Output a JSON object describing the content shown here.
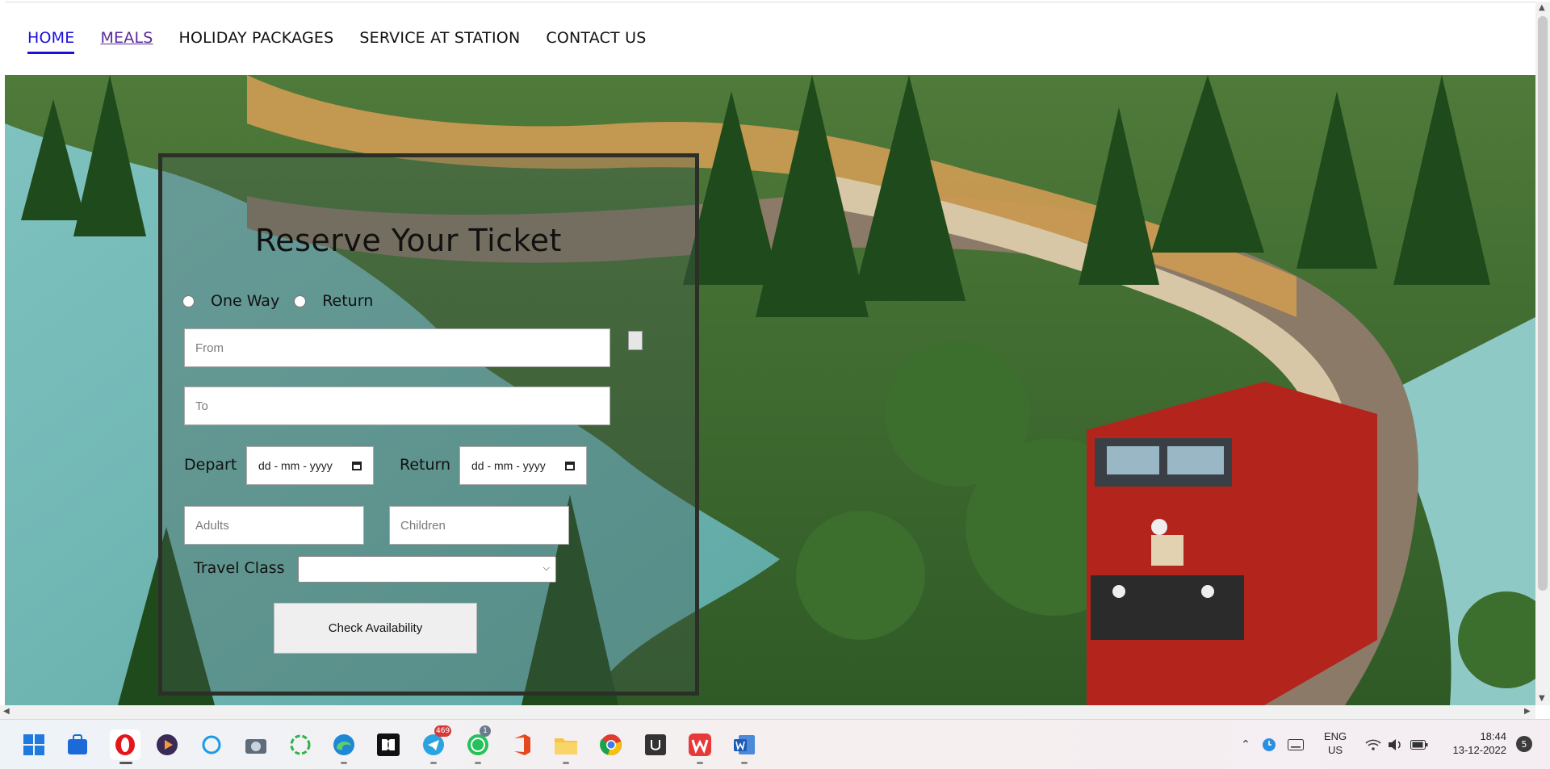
{
  "nav": {
    "items": [
      {
        "label": "HOME",
        "state": "active"
      },
      {
        "label": "MEALS",
        "state": "visited"
      },
      {
        "label": "HOLIDAY PACKAGES",
        "state": "normal"
      },
      {
        "label": "SERVICE AT STATION",
        "state": "normal"
      },
      {
        "label": "CONTACT US",
        "state": "normal"
      }
    ]
  },
  "booking": {
    "title": "Reserve Your Ticket",
    "trip_options": [
      "One Way",
      "Return"
    ],
    "from_placeholder": "From",
    "to_placeholder": "To",
    "depart_label": "Depart",
    "return_label": "Return",
    "date_placeholder": "dd - mm - yyyy",
    "adults_placeholder": "Adults",
    "children_placeholder": "Children",
    "travel_class_label": "Travel Class",
    "travel_class_value": "",
    "submit_label": "Check Availability"
  },
  "taskbar": {
    "apps": [
      "windows-start",
      "microsoft-store",
      "opera",
      "media-player",
      "cortana",
      "camera",
      "loader-app",
      "edge",
      "dolby",
      "telegram",
      "whatsapp",
      "office",
      "file-explorer",
      "chrome",
      "unity",
      "wps",
      "word"
    ],
    "telegram_badge": "469",
    "whatsapp_badge": "1",
    "language_line1": "ENG",
    "language_line2": "US",
    "time": "18:44",
    "date": "13-12-2022",
    "notification_count": "5"
  },
  "colors": {
    "nav_active": "#1a10d8",
    "nav_visited": "#5a2a9a",
    "locomotive_red": "#b3241c"
  }
}
